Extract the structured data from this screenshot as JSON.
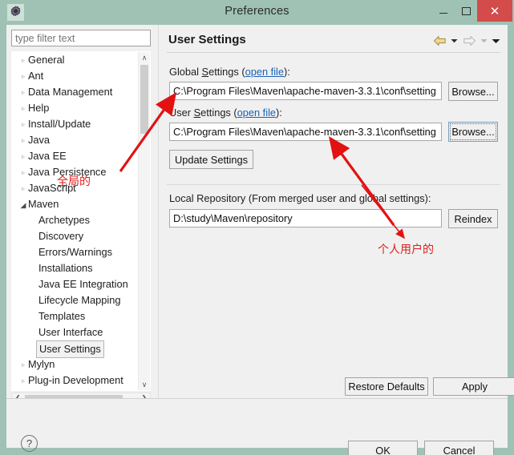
{
  "window": {
    "title": "Preferences",
    "icon": "gear-icon",
    "minimize_label": "–",
    "maximize_label": "□",
    "close_label": "✕"
  },
  "sidebar": {
    "filter_placeholder": "type filter text",
    "filter_value": "",
    "items": [
      {
        "label": "General",
        "level": 1,
        "twisty": "collapsed",
        "selected": false
      },
      {
        "label": "Ant",
        "level": 1,
        "twisty": "collapsed",
        "selected": false
      },
      {
        "label": "Data Management",
        "level": 1,
        "twisty": "collapsed",
        "selected": false
      },
      {
        "label": "Help",
        "level": 1,
        "twisty": "collapsed",
        "selected": false
      },
      {
        "label": "Install/Update",
        "level": 1,
        "twisty": "collapsed",
        "selected": false
      },
      {
        "label": "Java",
        "level": 1,
        "twisty": "collapsed",
        "selected": false
      },
      {
        "label": "Java EE",
        "level": 1,
        "twisty": "collapsed",
        "selected": false
      },
      {
        "label": "Java Persistence",
        "level": 1,
        "twisty": "collapsed",
        "selected": false
      },
      {
        "label": "JavaScript",
        "level": 1,
        "twisty": "collapsed",
        "selected": false
      },
      {
        "label": "Maven",
        "level": 1,
        "twisty": "expanded",
        "selected": false
      },
      {
        "label": "Archetypes",
        "level": 2,
        "twisty": "none",
        "selected": false
      },
      {
        "label": "Discovery",
        "level": 2,
        "twisty": "none",
        "selected": false
      },
      {
        "label": "Errors/Warnings",
        "level": 2,
        "twisty": "none",
        "selected": false
      },
      {
        "label": "Installations",
        "level": 2,
        "twisty": "none",
        "selected": false
      },
      {
        "label": "Java EE Integration",
        "level": 2,
        "twisty": "none",
        "selected": false
      },
      {
        "label": "Lifecycle Mapping",
        "level": 2,
        "twisty": "none",
        "selected": false
      },
      {
        "label": "Templates",
        "level": 2,
        "twisty": "none",
        "selected": false
      },
      {
        "label": "User Interface",
        "level": 2,
        "twisty": "none",
        "selected": false
      },
      {
        "label": "User Settings",
        "level": 2,
        "twisty": "none",
        "selected": true
      },
      {
        "label": "Mylyn",
        "level": 1,
        "twisty": "collapsed",
        "selected": false
      },
      {
        "label": "Plug-in Development",
        "level": 1,
        "twisty": "collapsed",
        "selected": false
      }
    ],
    "scroll_up": "∧",
    "scroll_down": "∨",
    "scroll_left": "❮",
    "scroll_right": "❯"
  },
  "content": {
    "page_title": "User Settings",
    "nav": {
      "back_icon": "back-arrow-icon",
      "back_caret": "▾",
      "forward_icon": "forward-arrow-icon",
      "forward_caret": "▾",
      "menu_caret": "▾"
    },
    "global_settings": {
      "label_prefix": "Global ",
      "label_underlined": "S",
      "label_suffix": "ettings (",
      "link": "open file",
      "label_end": "):",
      "value": "C:\\Program Files\\Maven\\apache-maven-3.3.1\\conf\\setting",
      "browse_label": "Browse..."
    },
    "user_settings": {
      "label_prefix": "User ",
      "label_underlined": "S",
      "label_suffix": "ettings (",
      "link": "open file",
      "label_end": "):",
      "value": "C:\\Program Files\\Maven\\apache-maven-3.3.1\\conf\\setting",
      "browse_label": "Browse..."
    },
    "update_settings_label": "Update Settings",
    "local_repository": {
      "label": "Local Repository (From merged user and global settings):",
      "value": "D:\\study\\Maven\\repository",
      "reindex_label": "Reindex"
    },
    "restore_defaults_label": "Restore Defaults",
    "apply_label": "Apply"
  },
  "footer": {
    "help_icon_label": "?",
    "ok_label": "OK",
    "cancel_label": "Cancel"
  },
  "annotations": [
    {
      "text": "全局的",
      "note": "global"
    },
    {
      "text": "个人用户的",
      "note": "personal user"
    }
  ],
  "colors": {
    "window_chrome": "#9fc2b4",
    "close_button": "#d44b4b",
    "dialog_bg": "#f0f0f0",
    "link": "#1a62b8",
    "annotation_red": "#e01b1b",
    "nav_back_arrow": "#e8d58a"
  }
}
